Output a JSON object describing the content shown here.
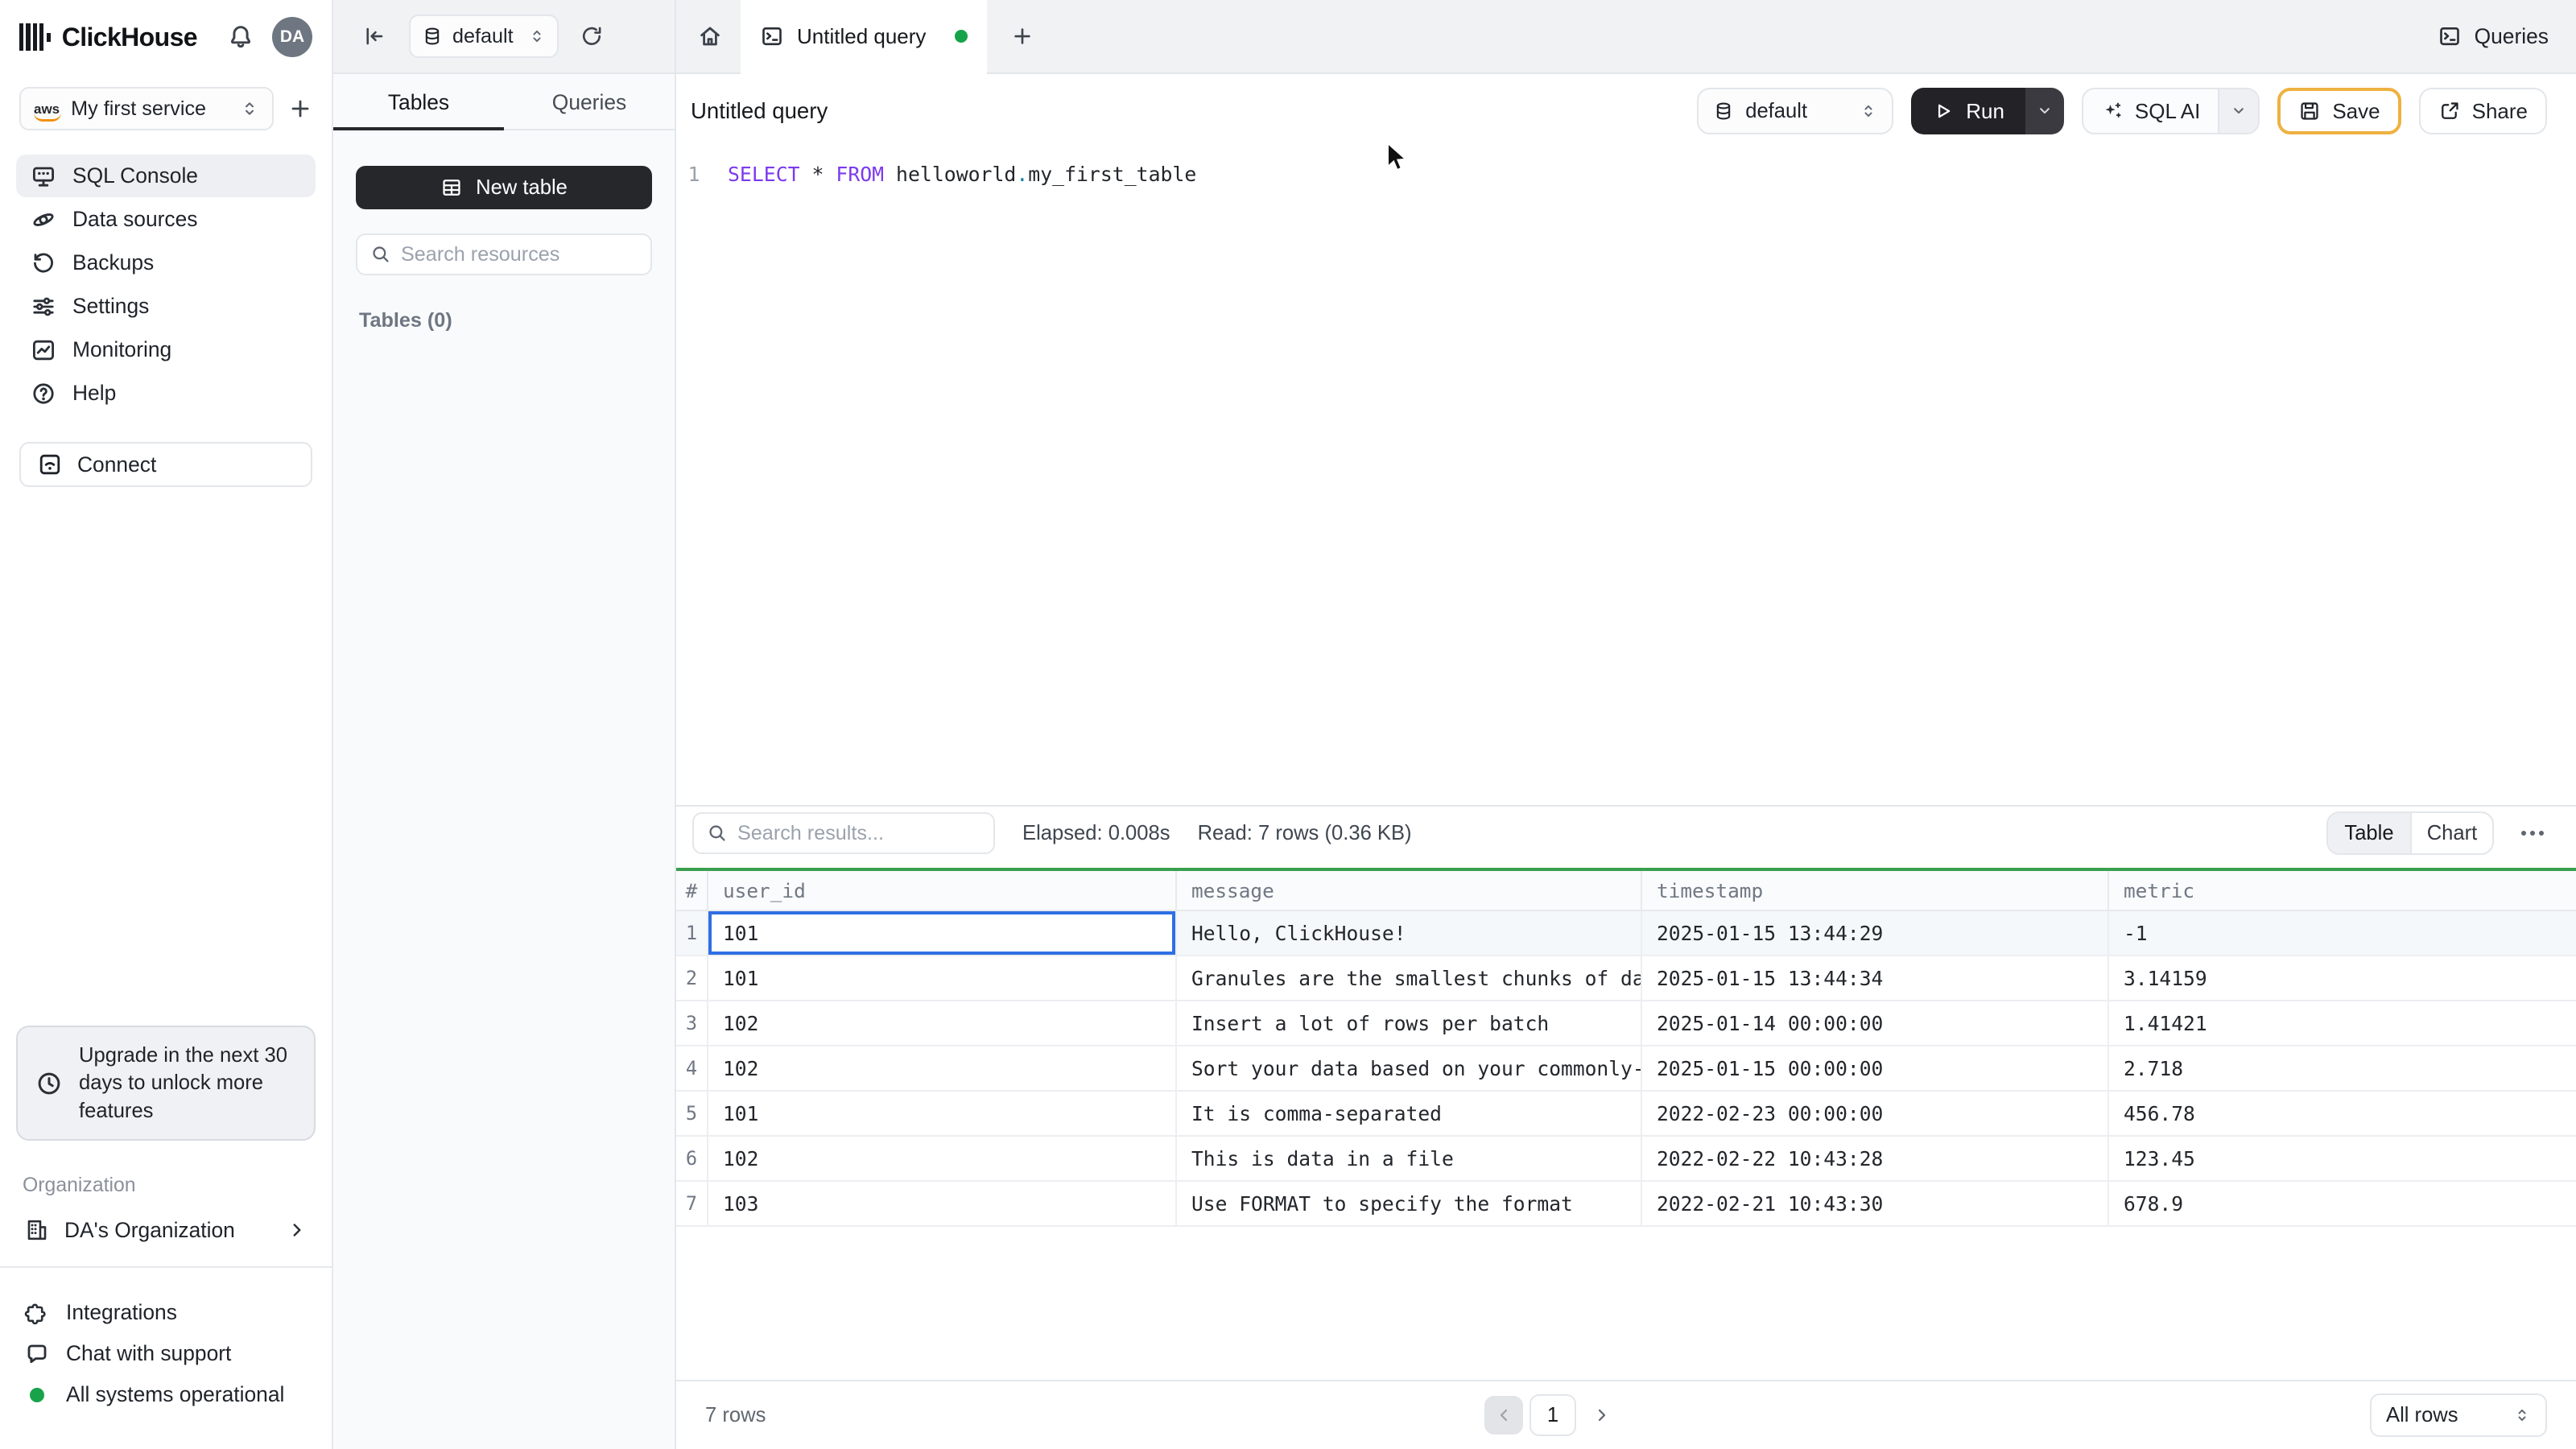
{
  "brand": {
    "name": "ClickHouse",
    "avatar_initials": "DA"
  },
  "sidebar": {
    "service": {
      "label": "My first service",
      "provider": "aws"
    },
    "items": [
      {
        "label": "SQL Console"
      },
      {
        "label": "Data sources"
      },
      {
        "label": "Backups"
      },
      {
        "label": "Settings"
      },
      {
        "label": "Monitoring"
      },
      {
        "label": "Help"
      }
    ],
    "connect_label": "Connect",
    "upgrade_notice": "Upgrade in the next 30 days to unlock more features",
    "organization_label": "Organization",
    "organization_name": "DA's Organization",
    "footer": {
      "integrations": "Integrations",
      "chat": "Chat with support",
      "status": "All systems operational"
    }
  },
  "top_strip": {
    "db_selector": "default",
    "tab_title": "Untitled query",
    "queries_button": "Queries"
  },
  "tables_panel": {
    "tab_tables": "Tables",
    "tab_queries": "Queries",
    "new_table": "New table",
    "search_placeholder": "Search resources",
    "section_label": "Tables (0)"
  },
  "toolbar": {
    "title": "Untitled query",
    "db_selector": "default",
    "run": "Run",
    "sql_ai": "SQL AI",
    "save": "Save",
    "share": "Share"
  },
  "editor": {
    "line_number": "1",
    "sql": {
      "kw1": "SELECT",
      "star": "*",
      "kw2": "FROM",
      "schema": "helloworld",
      "dot": ".",
      "table": "my_first_table"
    }
  },
  "results": {
    "search_placeholder": "Search results...",
    "elapsed": "Elapsed: 0.008s",
    "read": "Read: 7 rows (0.36 KB)",
    "toggle": {
      "table": "Table",
      "chart": "Chart"
    },
    "columns": [
      "#",
      "user_id",
      "message",
      "timestamp",
      "metric"
    ],
    "rows": [
      {
        "n": "1",
        "user_id": "101",
        "message": "Hello, ClickHouse!",
        "timestamp": "2025-01-15 13:44:29",
        "metric": "-1"
      },
      {
        "n": "2",
        "user_id": "101",
        "message": "Granules are the smallest chunks of data read",
        "timestamp": "2025-01-15 13:44:34",
        "metric": "3.14159"
      },
      {
        "n": "3",
        "user_id": "102",
        "message": "Insert a lot of rows per batch",
        "timestamp": "2025-01-14 00:00:00",
        "metric": "1.41421"
      },
      {
        "n": "4",
        "user_id": "102",
        "message": "Sort your data based on your commonly-used que…",
        "timestamp": "2025-01-15 00:00:00",
        "metric": "2.718"
      },
      {
        "n": "5",
        "user_id": "101",
        "message": "It is comma-separated",
        "timestamp": "2022-02-23 00:00:00",
        "metric": "456.78"
      },
      {
        "n": "6",
        "user_id": "102",
        "message": "This is data in a file",
        "timestamp": "2022-02-22 10:43:28",
        "metric": "123.45"
      },
      {
        "n": "7",
        "user_id": "103",
        "message": "Use FORMAT to specify the format",
        "timestamp": "2022-02-21 10:43:30",
        "metric": "678.9"
      }
    ],
    "footer": {
      "row_count": "7 rows",
      "page": "1",
      "page_size": "All rows"
    }
  },
  "colors": {
    "table_accent_green": "#3a9e4d",
    "save_border_amber": "#eeb140",
    "selection_blue": "#2f6fe4",
    "status_green": "#18a34a"
  }
}
